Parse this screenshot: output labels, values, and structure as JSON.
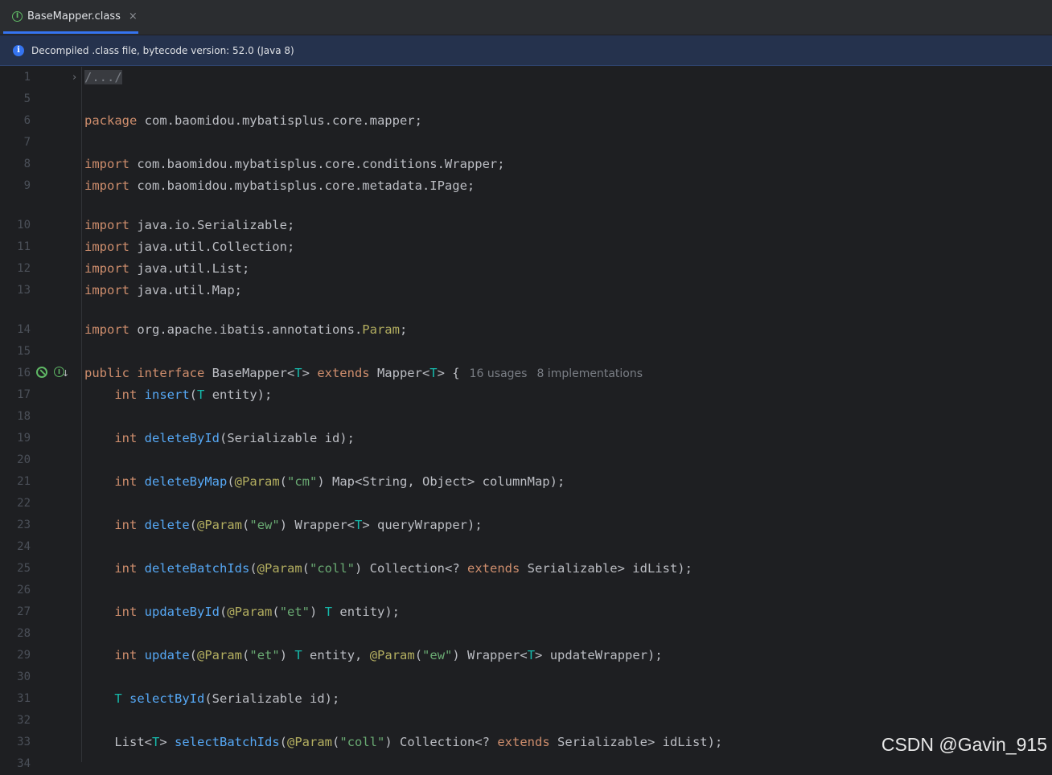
{
  "tab": {
    "title": "BaseMapper.class",
    "file_icon": "interface-file-icon",
    "close": "×"
  },
  "banner": {
    "text": "Decompiled .class file, bytecode version: 52.0 (Java 8)"
  },
  "editor": {
    "lines": [
      {
        "num": "1",
        "tokens": [
          {
            "t": "/.../",
            "c": "fold"
          }
        ],
        "fold_icon": "›"
      },
      {
        "num": "5",
        "tokens": []
      },
      {
        "num": "6",
        "tokens": [
          {
            "t": "package",
            "c": "kw"
          },
          {
            "t": " com.baomidou.mybatisplus.core.mapper;"
          }
        ]
      },
      {
        "num": "7",
        "tokens": []
      },
      {
        "num": "8",
        "tokens": [
          {
            "t": "import",
            "c": "kw"
          },
          {
            "t": " com.baomidou.mybatisplus.core.conditions.Wrapper;"
          }
        ]
      },
      {
        "num": "9",
        "tokens": [
          {
            "t": "import",
            "c": "kw"
          },
          {
            "t": " com.baomidou.mybatisplus.core.metadata.IPage;"
          }
        ]
      },
      {
        "num": "10",
        "tokens": [
          {
            "t": "import",
            "c": "kw"
          },
          {
            "t": " java.io.Serializable;"
          }
        ]
      },
      {
        "num": "11",
        "tokens": [
          {
            "t": "import",
            "c": "kw"
          },
          {
            "t": " java.util.Collection;"
          }
        ]
      },
      {
        "num": "12",
        "tokens": [
          {
            "t": "import",
            "c": "kw"
          },
          {
            "t": " java.util.List;"
          }
        ]
      },
      {
        "num": "13",
        "tokens": [
          {
            "t": "import",
            "c": "kw"
          },
          {
            "t": " java.util.Map;"
          }
        ]
      },
      {
        "num": "14",
        "tokens": [
          {
            "t": "import",
            "c": "kw"
          },
          {
            "t": " org.apache.ibatis.annotations."
          },
          {
            "t": "Param",
            "c": "an"
          },
          {
            "t": ";"
          }
        ]
      },
      {
        "num": "15",
        "tokens": []
      },
      {
        "num": "16",
        "tokens": [
          {
            "t": "public interface",
            "c": "kw"
          },
          {
            "t": " BaseMapper<"
          },
          {
            "t": "T",
            "c": "tp"
          },
          {
            "t": "> "
          },
          {
            "t": "extends",
            "c": "kw"
          },
          {
            "t": " Mapper<"
          },
          {
            "t": "T",
            "c": "tp"
          },
          {
            "t": "> {"
          },
          {
            "t": "16 usages",
            "c": "hint"
          },
          {
            "t": "8 implementations",
            "c": "hint"
          }
        ],
        "gutter_icons": true
      },
      {
        "num": "17",
        "tokens": [
          {
            "t": "    "
          },
          {
            "t": "int",
            "c": "kw"
          },
          {
            "t": " "
          },
          {
            "t": "insert",
            "c": "fn"
          },
          {
            "t": "("
          },
          {
            "t": "T",
            "c": "tp"
          },
          {
            "t": " entity);"
          }
        ]
      },
      {
        "num": "18",
        "tokens": []
      },
      {
        "num": "19",
        "tokens": [
          {
            "t": "    "
          },
          {
            "t": "int",
            "c": "kw"
          },
          {
            "t": " "
          },
          {
            "t": "deleteById",
            "c": "fn"
          },
          {
            "t": "(Serializable id);"
          }
        ]
      },
      {
        "num": "20",
        "tokens": []
      },
      {
        "num": "21",
        "tokens": [
          {
            "t": "    "
          },
          {
            "t": "int",
            "c": "kw"
          },
          {
            "t": " "
          },
          {
            "t": "deleteByMap",
            "c": "fn"
          },
          {
            "t": "("
          },
          {
            "t": "@Param",
            "c": "an"
          },
          {
            "t": "("
          },
          {
            "t": "\"cm\"",
            "c": "st"
          },
          {
            "t": ") Map<String, Object> columnMap);"
          }
        ]
      },
      {
        "num": "22",
        "tokens": []
      },
      {
        "num": "23",
        "tokens": [
          {
            "t": "    "
          },
          {
            "t": "int",
            "c": "kw"
          },
          {
            "t": " "
          },
          {
            "t": "delete",
            "c": "fn"
          },
          {
            "t": "("
          },
          {
            "t": "@Param",
            "c": "an"
          },
          {
            "t": "("
          },
          {
            "t": "\"ew\"",
            "c": "st"
          },
          {
            "t": ") Wrapper<"
          },
          {
            "t": "T",
            "c": "tp"
          },
          {
            "t": "> queryWrapper);"
          }
        ]
      },
      {
        "num": "24",
        "tokens": []
      },
      {
        "num": "25",
        "tokens": [
          {
            "t": "    "
          },
          {
            "t": "int",
            "c": "kw"
          },
          {
            "t": " "
          },
          {
            "t": "deleteBatchIds",
            "c": "fn"
          },
          {
            "t": "("
          },
          {
            "t": "@Param",
            "c": "an"
          },
          {
            "t": "("
          },
          {
            "t": "\"coll\"",
            "c": "st"
          },
          {
            "t": ") Collection<? "
          },
          {
            "t": "extends",
            "c": "kw"
          },
          {
            "t": " Serializable> idList);"
          }
        ]
      },
      {
        "num": "26",
        "tokens": []
      },
      {
        "num": "27",
        "tokens": [
          {
            "t": "    "
          },
          {
            "t": "int",
            "c": "kw"
          },
          {
            "t": " "
          },
          {
            "t": "updateById",
            "c": "fn"
          },
          {
            "t": "("
          },
          {
            "t": "@Param",
            "c": "an"
          },
          {
            "t": "("
          },
          {
            "t": "\"et\"",
            "c": "st"
          },
          {
            "t": ") "
          },
          {
            "t": "T",
            "c": "tp"
          },
          {
            "t": " entity);"
          }
        ]
      },
      {
        "num": "28",
        "tokens": []
      },
      {
        "num": "29",
        "tokens": [
          {
            "t": "    "
          },
          {
            "t": "int",
            "c": "kw"
          },
          {
            "t": " "
          },
          {
            "t": "update",
            "c": "fn"
          },
          {
            "t": "("
          },
          {
            "t": "@Param",
            "c": "an"
          },
          {
            "t": "("
          },
          {
            "t": "\"et\"",
            "c": "st"
          },
          {
            "t": ") "
          },
          {
            "t": "T",
            "c": "tp"
          },
          {
            "t": " entity, "
          },
          {
            "t": "@Param",
            "c": "an"
          },
          {
            "t": "("
          },
          {
            "t": "\"ew\"",
            "c": "st"
          },
          {
            "t": ") Wrapper<"
          },
          {
            "t": "T",
            "c": "tp"
          },
          {
            "t": "> updateWrapper);"
          }
        ]
      },
      {
        "num": "30",
        "tokens": []
      },
      {
        "num": "31",
        "tokens": [
          {
            "t": "    "
          },
          {
            "t": "T",
            "c": "tp"
          },
          {
            "t": " "
          },
          {
            "t": "selectById",
            "c": "fn"
          },
          {
            "t": "(Serializable id);"
          }
        ]
      },
      {
        "num": "32",
        "tokens": []
      },
      {
        "num": "33",
        "tokens": [
          {
            "t": "    List<"
          },
          {
            "t": "T",
            "c": "tp"
          },
          {
            "t": "> "
          },
          {
            "t": "selectBatchIds",
            "c": "fn"
          },
          {
            "t": "("
          },
          {
            "t": "@Param",
            "c": "an"
          },
          {
            "t": "("
          },
          {
            "t": "\"coll\"",
            "c": "st"
          },
          {
            "t": ") Collection<? "
          },
          {
            "t": "extends",
            "c": "kw"
          },
          {
            "t": " Serializable> idList);"
          }
        ]
      },
      {
        "num": "34",
        "tokens": []
      }
    ]
  },
  "watermark": "CSDN @Gavin_915"
}
